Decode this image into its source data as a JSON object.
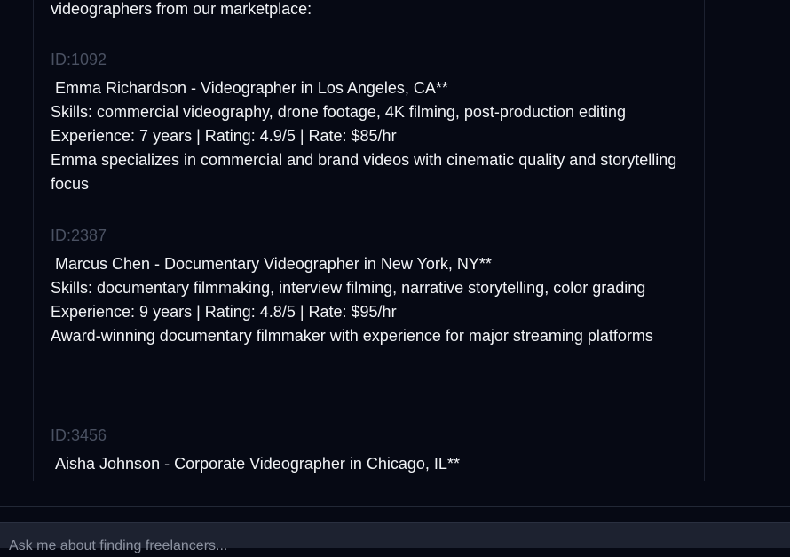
{
  "chat": {
    "intro_text": "videographers from our marketplace:",
    "listings": [
      {
        "id": "ID:1092",
        "name": "Emma Richardson - Videographer in Los Angeles, CA**",
        "skills": "Skills: commercial videography, drone footage, 4K filming, post-production editing",
        "stats": "Experience: 7 years | Rating: 4.9/5 | Rate: $85/hr",
        "bio": "Emma specializes in commercial and brand videos with cinematic quality and storytelling focus"
      },
      {
        "id": "ID:2387",
        "name": "Marcus Chen - Documentary Videographer in New York, NY**",
        "skills": "Skills: documentary filmmaking, interview filming, narrative storytelling, color grading",
        "stats": "Experience: 9 years | Rating: 4.8/5 | Rate: $95/hr",
        "bio": "Award-winning documentary filmmaker with experience for major streaming platforms"
      },
      {
        "id": "ID:3456",
        "name": "Aisha Johnson - Corporate Videographer in Chicago, IL**"
      }
    ]
  },
  "input": {
    "placeholder": "Ask me about finding freelancers..."
  }
}
